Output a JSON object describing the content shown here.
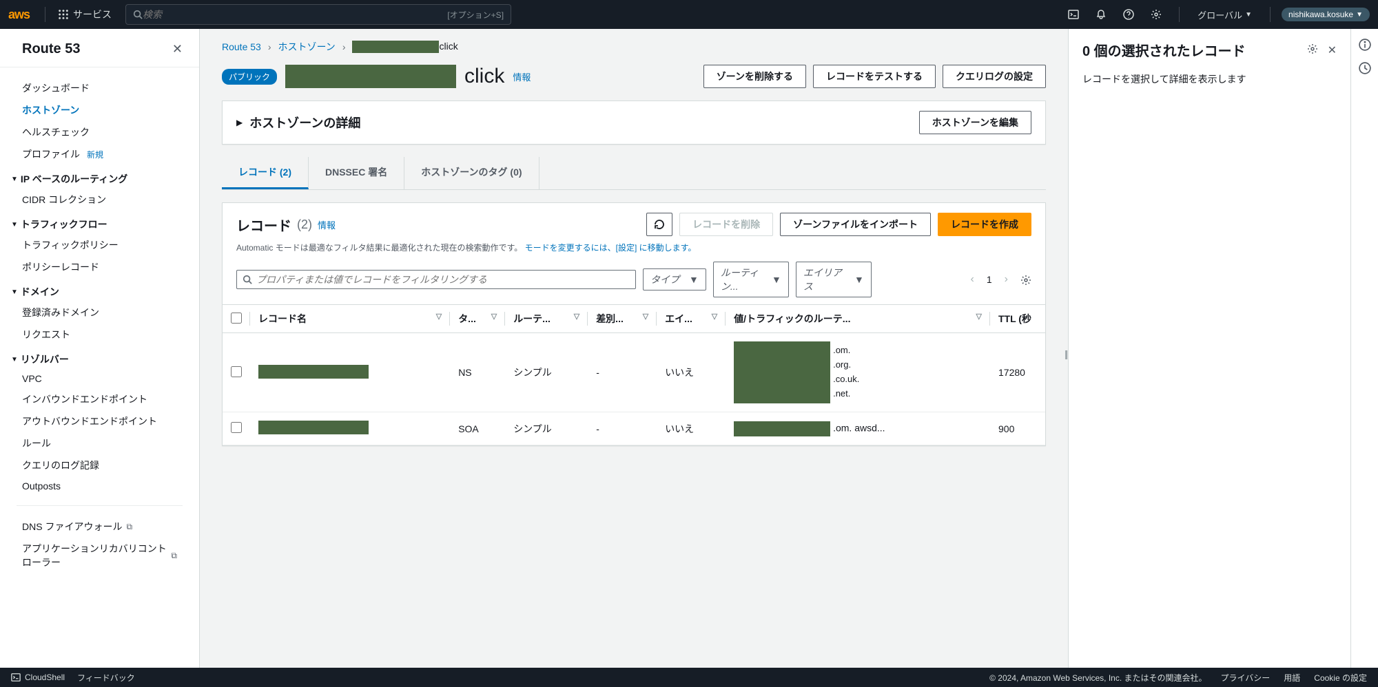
{
  "topnav": {
    "services": "サービス",
    "search_placeholder": "検索",
    "shortcut": "[オプション+S]",
    "region": "グローバル",
    "user": "nishikawa.kosuke"
  },
  "sidebar": {
    "title": "Route 53",
    "items": [
      {
        "label": "ダッシュボード"
      },
      {
        "label": "ホストゾーン",
        "active": true
      },
      {
        "label": "ヘルスチェック"
      },
      {
        "label": "プロファイル",
        "new": "新規"
      }
    ],
    "sections": [
      {
        "title": "IP ベースのルーティング",
        "items": [
          "CIDR コレクション"
        ]
      },
      {
        "title": "トラフィックフロー",
        "items": [
          "トラフィックポリシー",
          "ポリシーレコード"
        ]
      },
      {
        "title": "ドメイン",
        "items": [
          "登録済みドメイン",
          "リクエスト"
        ]
      },
      {
        "title": "リゾルバー",
        "items": [
          "VPC",
          "インバウンドエンドポイント",
          "アウトバウンドエンドポイント",
          "ルール",
          "クエリのログ記録",
          "Outposts"
        ]
      }
    ],
    "footer_links": [
      {
        "label": "DNS ファイアウォール",
        "ext": true
      },
      {
        "label": "アプリケーションリカバリコントローラー",
        "ext": true
      }
    ]
  },
  "breadcrumb": {
    "root": "Route 53",
    "hosted": "ホストゾーン",
    "suffix": "click"
  },
  "title": {
    "public_badge": "パブリック",
    "suffix": "click",
    "info": "情報"
  },
  "title_actions": {
    "delete_zone": "ゾーンを削除する",
    "test_record": "レコードをテストする",
    "query_log": "クエリログの設定"
  },
  "details_panel": {
    "title": "ホストゾーンの詳細",
    "edit": "ホストゾーンを編集"
  },
  "tabs": {
    "records": "レコード (2)",
    "dnssec": "DNSSEC 署名",
    "tags": "ホストゾーンのタグ (0)"
  },
  "records": {
    "title": "レコード",
    "count": "(2)",
    "info": "情報",
    "refresh": "refresh",
    "delete": "レコードを削除",
    "import": "ゾーンファイルをインポート",
    "create": "レコードを作成",
    "auto_note_pre": "Automatic モードは最適なフィルタ結果に最適化された現在の検索動作です。",
    "auto_note_link": "モードを変更するには、[設定] に移動します。",
    "filter_placeholder": "プロパティまたは値でレコードをフィルタリングする",
    "filters": {
      "type": "タイプ",
      "routing": "ルーティン...",
      "alias": "エイリアス"
    },
    "page": "1"
  },
  "table": {
    "headers": {
      "name": "レコード名",
      "type": "タ...",
      "routing": "ルーテ...",
      "diff": "差別...",
      "alias": "エイ...",
      "value": "値/トラフィックのルーテ...",
      "ttl": "TTL (秒"
    },
    "rows": [
      {
        "type": "NS",
        "routing": "シンプル",
        "diff": "-",
        "alias": "いいえ",
        "value_suffixes": [
          ".om.",
          ".org.",
          ".co.uk.",
          ".net."
        ],
        "ttl": "17280"
      },
      {
        "type": "SOA",
        "routing": "シンプル",
        "diff": "-",
        "alias": "いいえ",
        "value_suffix": ".om. awsd...",
        "ttl": "900"
      }
    ]
  },
  "rightpane": {
    "title": "0 個の選択されたレコード",
    "body": "レコードを選択して詳細を表示します"
  },
  "footer": {
    "cloudshell": "CloudShell",
    "feedback": "フィードバック",
    "copyright": "© 2024, Amazon Web Services, Inc. またはその関連会社。",
    "privacy": "プライバシー",
    "terms": "用語",
    "cookie": "Cookie の設定"
  }
}
